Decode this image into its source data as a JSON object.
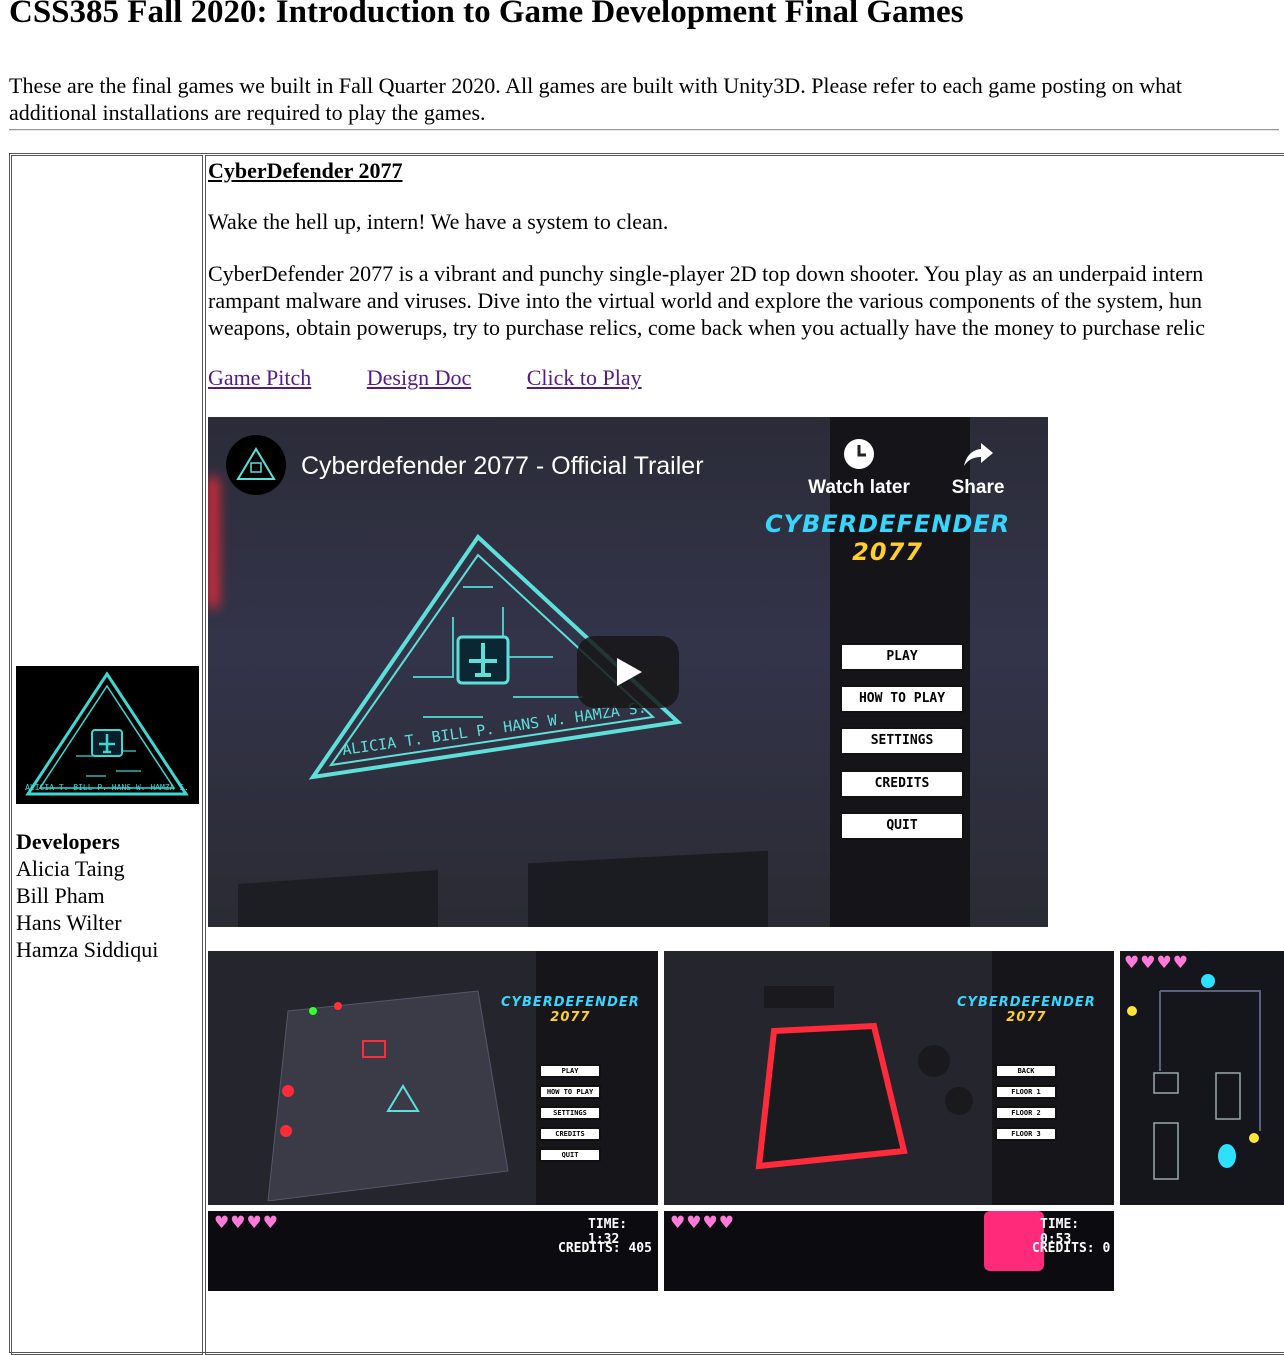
{
  "page": {
    "title": "CSS385 Fall 2020: Introduction to Game Development Final Games",
    "intro": "These are the final games we built in Fall Quarter 2020. All games are built with Unity3D. Please refer to each game posting on what additional installations are required to play the games."
  },
  "game": {
    "title": "CyberDefender 2077",
    "tagline": "Wake the hell up, intern! We have a system to clean.",
    "description_lines": [
      "CyberDefender 2077 is a vibrant and punchy single-player 2D top down shooter. You play as an underpaid intern",
      "rampant malware and viruses. Dive into the virtual world and explore the various components of the system, hun",
      "weapons, obtain powerups, try to purchase relics, come back when you actually have the money to purchase relic"
    ],
    "links": [
      "Game Pitch",
      "Design Doc",
      "Click to Play"
    ],
    "developers_heading": "Developers",
    "developers": [
      "Alicia Taing",
      "Bill Pham",
      "Hans Wilter",
      "Hamza Siddiqui"
    ]
  },
  "video": {
    "title": "Cyberdefender 2077 - Official Trailer",
    "watch_later": "Watch later",
    "share": "Share",
    "logo_line1": "CYBERDEFENDER",
    "logo_line2": "2077",
    "triangle_text": "ALICIA T.  BILL P.  HANS W.  HAMZA S.",
    "menu": [
      "PLAY",
      "HOW TO PLAY",
      "SETTINGS",
      "CREDITS",
      "QUIT"
    ]
  },
  "screenshots": {
    "shot1_menu": [
      "PLAY",
      "HOW TO PLAY",
      "SETTINGS",
      "CREDITS",
      "QUIT"
    ],
    "shot2_menu": [
      "BACK",
      "FLOOR 1",
      "FLOOR 2",
      "FLOOR 3"
    ],
    "shot4_time": "TIME: 1:32",
    "shot4_credits": "CREDITS: 405",
    "shot5_time": "TIME: 0:53",
    "shot5_credits": "CREDITS: 0",
    "hearts": "♥♥♥♥"
  },
  "colors": {
    "link_visited": "#551a8b",
    "cyber_blue": "#36d6ff",
    "cyber_yellow": "#ffcf2e",
    "neon_red": "#ff2a3a",
    "heart_pink": "#ff7ad9"
  }
}
